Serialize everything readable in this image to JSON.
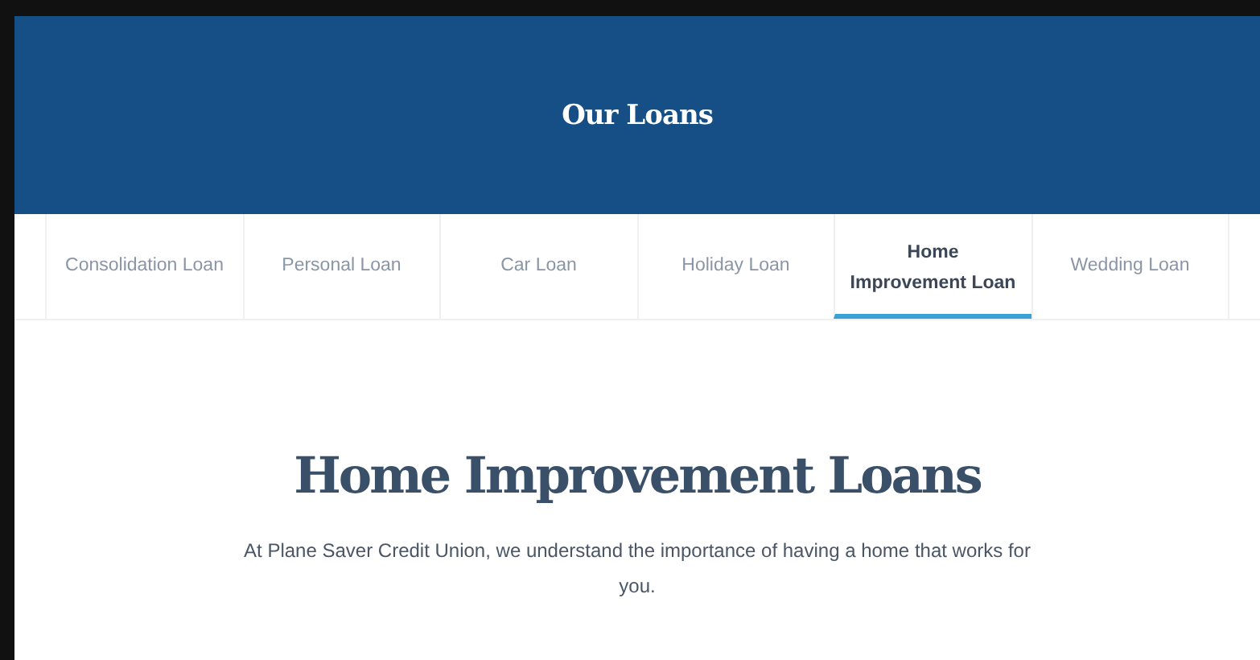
{
  "header": {
    "title": "Our Loans"
  },
  "tabs": [
    {
      "label": "Consolidation Loan",
      "selected": false
    },
    {
      "label": "Personal Loan",
      "selected": false
    },
    {
      "label": "Car Loan",
      "selected": false
    },
    {
      "label": "Holiday Loan",
      "selected": false
    },
    {
      "label": "Home Improvement Loan",
      "selected": true
    },
    {
      "label": "Wedding Loan",
      "selected": false
    }
  ],
  "content": {
    "heading": "Home Improvement Loans",
    "intro": "At Plane Saver Credit Union, we understand the importance of having a home that works for you."
  }
}
